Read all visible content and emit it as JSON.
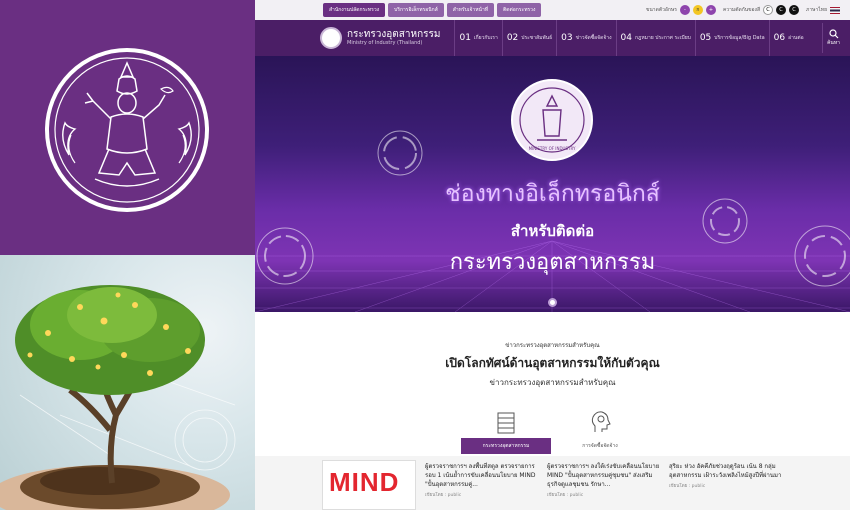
{
  "topbar": {
    "tabs": [
      "สำนักงานปลัดกระทรวง",
      "บริการอิเล็กทรอนิกส์",
      "สำหรับเจ้าหน้าที่",
      "ติดต่อกระทรวง"
    ],
    "font_label": "ขนาดตัวอักษร",
    "font_sizes": [
      "-",
      "ก",
      "+"
    ],
    "contrast_label": "ความตัดกันของสี",
    "contrast_options": [
      "C",
      "C",
      "C"
    ],
    "language_label": "ภาษาไทย"
  },
  "brand": {
    "name_th": "กระทรวงอุตสาหกรรม",
    "name_en": "Ministry of Industry (Thailand)"
  },
  "nav": [
    {
      "num": "01",
      "label": "เกี่ยวกับเรา"
    },
    {
      "num": "02",
      "label": "ประชาสัมพันธ์"
    },
    {
      "num": "03",
      "label": "ข่าวจัดซื้อจัดจ้าง"
    },
    {
      "num": "04",
      "label": "กฎหมาย ประกาศ ระเบียบ"
    },
    {
      "num": "05",
      "label": "บริการข้อมูล/Big Data"
    },
    {
      "num": "06",
      "label": "อ่านต่อ"
    }
  ],
  "search_label": "ค้นหา",
  "hero": {
    "title": "ช่องทางอิเล็กทรอนิกส์",
    "subtitle": "สำหรับติดต่อ",
    "ministry": "กระทรวงอุตสาหกรรม",
    "emblem_text": "MINISTRY OF INDUSTRY"
  },
  "news": {
    "label": "ข่าวกระทรวงอุตสาหกรรมสำหรับคุณ",
    "headline": "เปิดโลกทัศน์ด้านอุตสาหกรรมให้กับตัวคุณ",
    "subheadline": "ข่าวกระทรวงอุตสาหกรรมสำหรับคุณ",
    "tabs": [
      "กระทรวงอุตสาหกรรม",
      "การจัดซื้อจัดจ้าง"
    ],
    "thumb_text": "MIND",
    "cards": [
      {
        "title": "ผู้ตรวจราชการฯ ลงพื้นที่สตูล ตรวจรายการรอบ 1 เน้นย้ำการขับเคลื่อนนโยบาย MIND \"ปั้นอุตสาหกรรมคู่...",
        "meta": "เขียนโดย : public"
      },
      {
        "title": "ผู้ตรวจราชการฯ ลงใต้เร่งขับเคลื่อนนโยบาย MIND \"ปั้นอุตสาหกรรมคู่ชุมชน\" ส่งเสริมธุรกิจดูแลชุมชน รักษา...",
        "meta": "เขียนโดย : public"
      },
      {
        "title": "สุริยะ ห่วง อัคคีภัยช่วงฤดูร้อน เน้น 8 กลุ่มอุตสาหกรรม เฝ้าระวังเพลิงไหม้สูงปีที่ผ่านมา",
        "meta": "เขียนโดย : public"
      }
    ]
  },
  "colors": {
    "primary": "#6a2f82",
    "nav_bg": "#4b1e66",
    "accent_red": "#e3262f"
  }
}
